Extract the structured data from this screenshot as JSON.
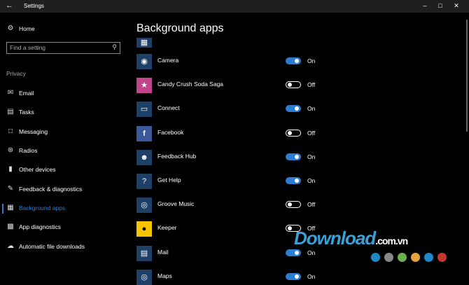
{
  "window": {
    "title": "Settings"
  },
  "sidebar": {
    "home_label": "Home",
    "search_placeholder": "Find a setting",
    "section_label": "Privacy",
    "items": [
      {
        "label": "Email"
      },
      {
        "label": "Tasks"
      },
      {
        "label": "Messaging"
      },
      {
        "label": "Radios"
      },
      {
        "label": "Other devices"
      },
      {
        "label": "Feedback & diagnostics"
      },
      {
        "label": "Background apps"
      },
      {
        "label": "App diagnostics"
      },
      {
        "label": "Automatic file downloads"
      }
    ]
  },
  "main": {
    "title": "Background apps",
    "apps": [
      {
        "name": "Camera",
        "state": "On"
      },
      {
        "name": "Candy Crush Soda Saga",
        "state": "Off"
      },
      {
        "name": "Connect",
        "state": "On"
      },
      {
        "name": "Facebook",
        "state": "Off"
      },
      {
        "name": "Feedback Hub",
        "state": "On"
      },
      {
        "name": "Get Help",
        "state": "On"
      },
      {
        "name": "Groove Music",
        "state": "Off"
      },
      {
        "name": "Keeper",
        "state": "Off"
      },
      {
        "name": "Mail",
        "state": "On"
      },
      {
        "name": "Maps",
        "state": "On"
      }
    ]
  },
  "watermark": {
    "brand": "Download",
    "suffix": ".com.vn"
  },
  "colors": {
    "accent": "#2e7cd0",
    "titlebar": "#1f1f1f",
    "background": "#000000"
  }
}
